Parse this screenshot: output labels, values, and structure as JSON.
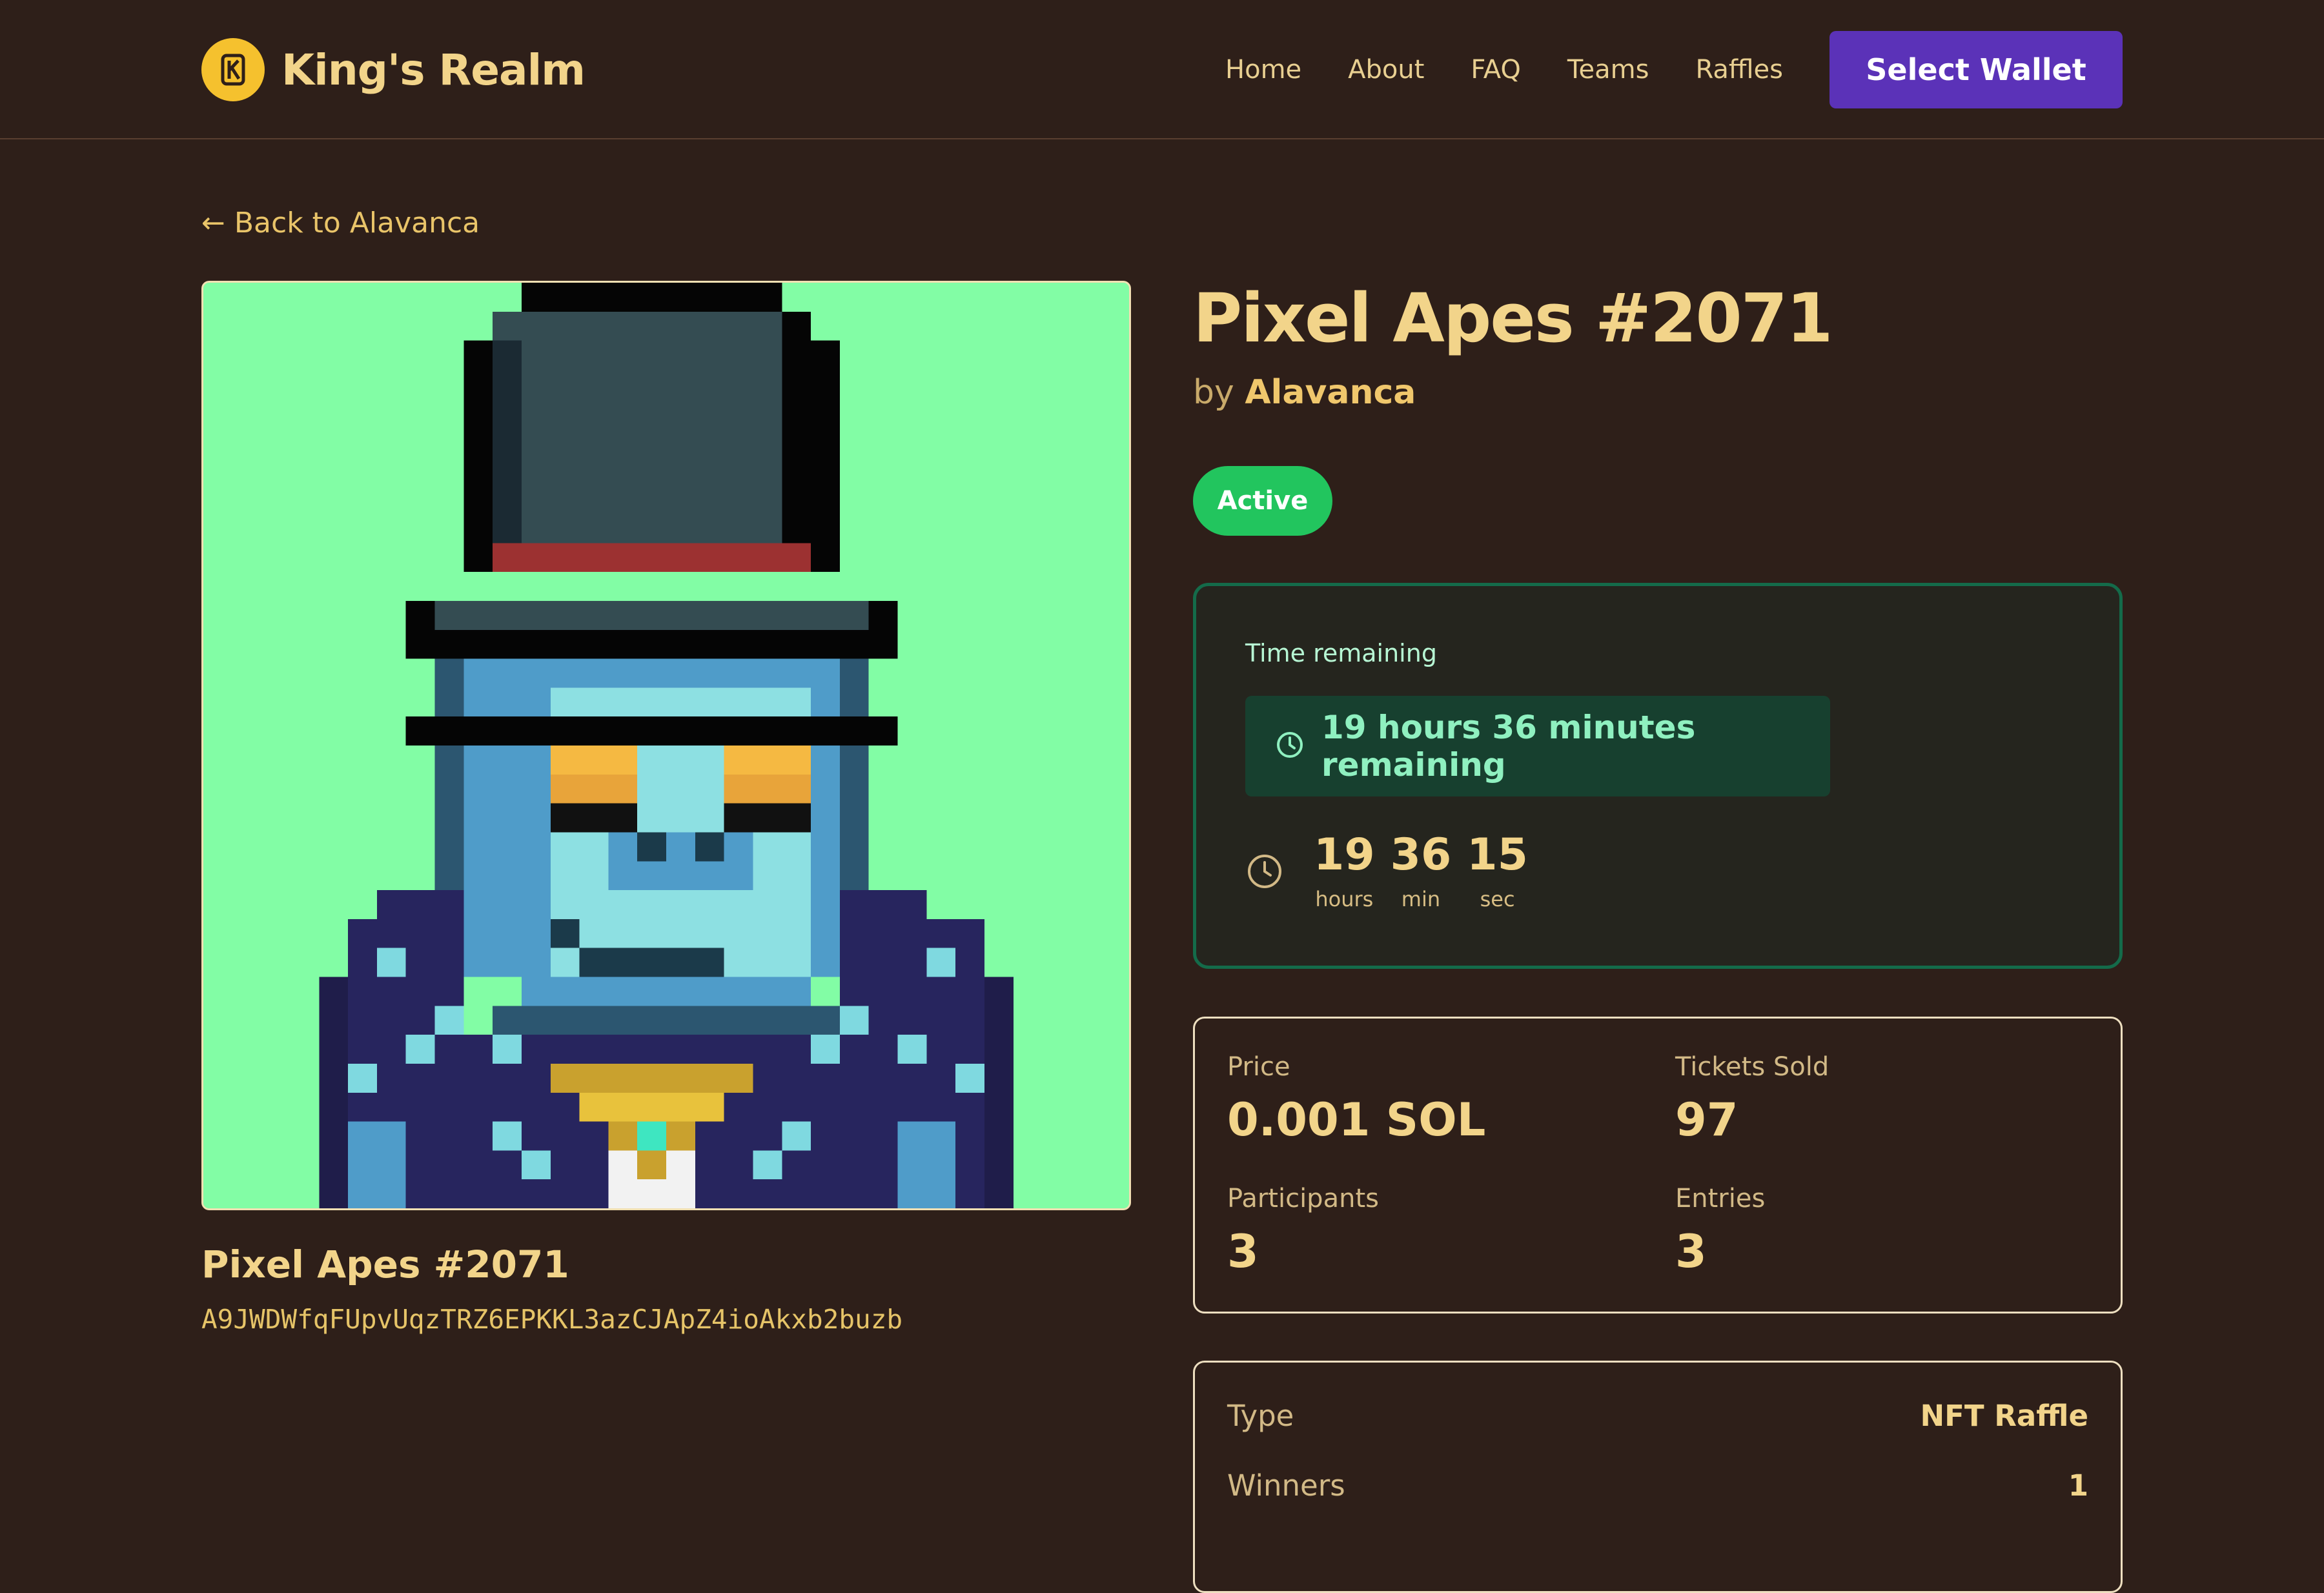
{
  "header": {
    "brand_name": "King's Realm",
    "nav": [
      {
        "label": "Home"
      },
      {
        "label": "About"
      },
      {
        "label": "FAQ"
      },
      {
        "label": "Teams"
      },
      {
        "label": "Raffles"
      }
    ],
    "wallet_button": "Select Wallet"
  },
  "back_link": "← Back to Alavanca",
  "nft": {
    "caption_title": "Pixel Apes #2071",
    "mint_address": "A9JWDWfqFUpvUqzTRZ6EPKKL3azCJApZ4ioAkxb2buzb",
    "background_color": "#82fda5"
  },
  "raffle": {
    "title": "Pixel Apes #2071",
    "by_prefix": "by",
    "creator": "Alavanca",
    "status": "Active"
  },
  "timer": {
    "label": "Time remaining",
    "summary": "19 hours 36 minutes remaining",
    "hours": "19",
    "minutes": "36",
    "seconds": "15",
    "hours_label": "hours",
    "minutes_label": "min",
    "seconds_label": "sec"
  },
  "stats": {
    "price_label": "Price",
    "price_value": "0.001 SOL",
    "tickets_label": "Tickets Sold",
    "tickets_value": "97",
    "participants_label": "Participants",
    "participants_value": "3",
    "entries_label": "Entries",
    "entries_value": "3"
  },
  "details": {
    "type_label": "Type",
    "type_value": "NFT Raffle",
    "winners_label": "Winners",
    "winners_value": "1"
  },
  "colors": {
    "accent_purple": "#5b32b8",
    "active_green": "#22c55e",
    "gold_text": "#f2d48a",
    "page_background": "#2e1f19"
  },
  "icons": [
    "king-logo-icon",
    "clock-icon",
    "back-arrow-icon"
  ]
}
